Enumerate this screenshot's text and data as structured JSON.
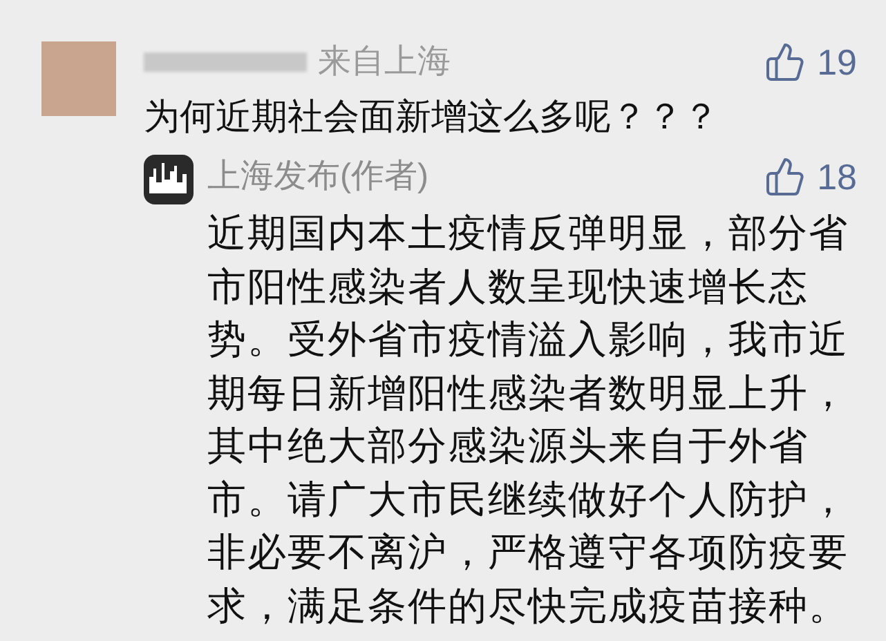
{
  "comment": {
    "location": "来自上海",
    "likes": "19",
    "text": "为何近期社会面新增这么多呢？？？"
  },
  "reply": {
    "author": "上海发布(作者)",
    "likes": "18",
    "text": "近期国内本土疫情反弹明显，部分省市阳性感染者人数呈现快速增长态势。受外省市疫情溢入影响，我市近期每日新增阳性感染者数明显上升，其中绝大部分感染源头来自于外省市。请广大市民继续做好个人防护，非必要不离沪，严格遵守各项防疫要求，满足条件的尽快完成疫苗接种。"
  }
}
